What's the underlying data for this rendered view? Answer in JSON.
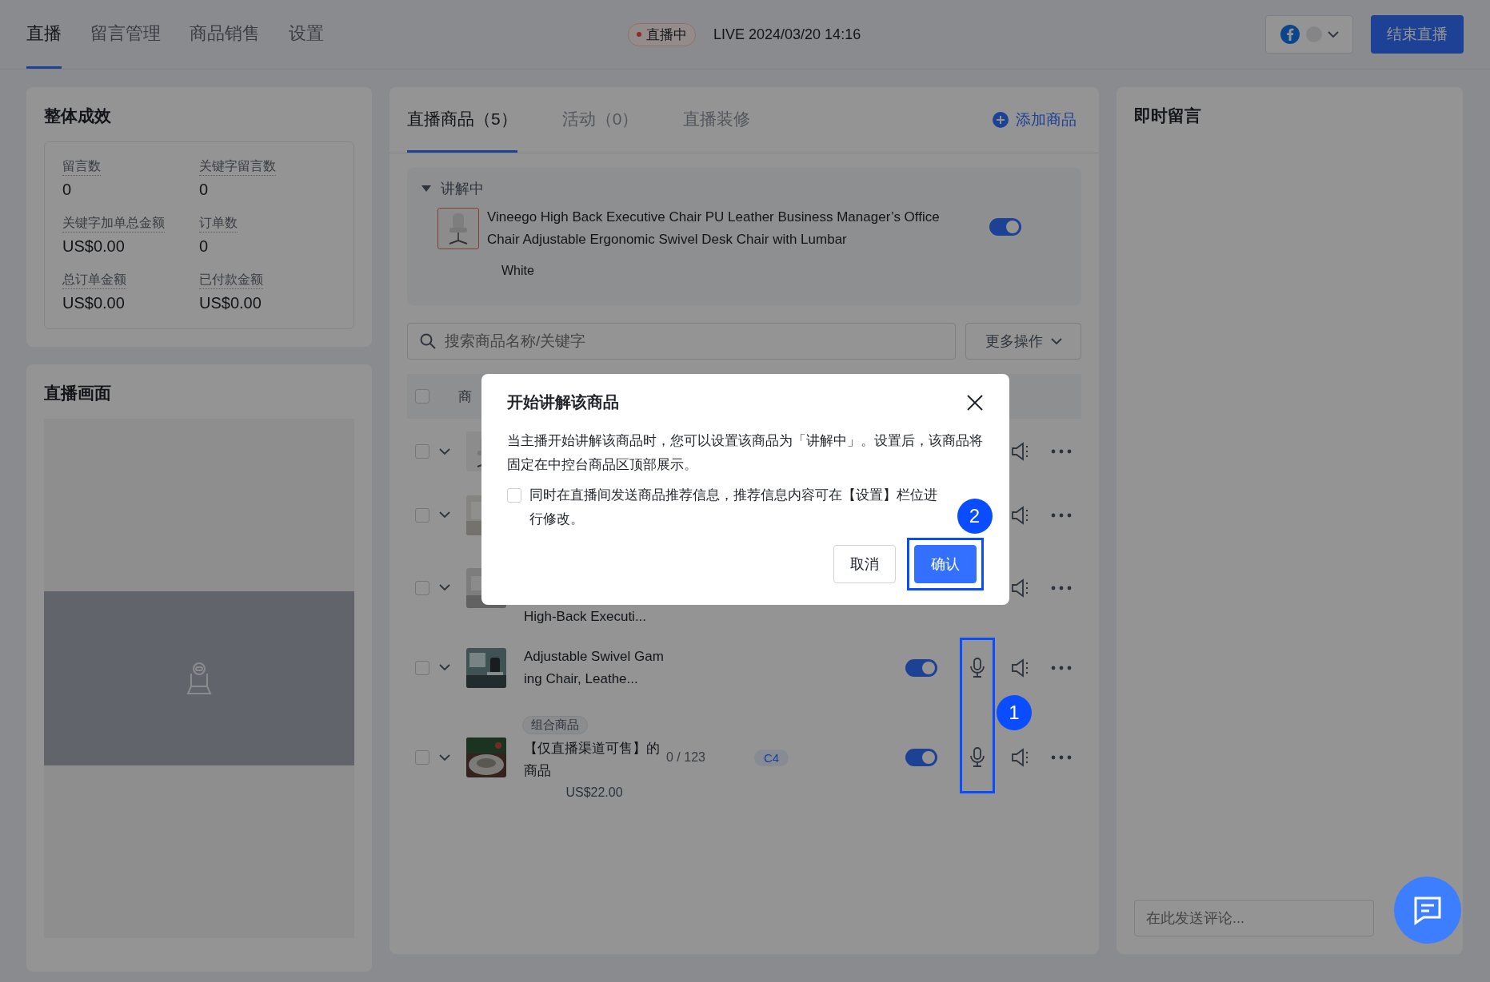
{
  "top_bar": {
    "tabs": [
      {
        "label": "直播",
        "selected": true
      },
      {
        "label": "留言管理",
        "selected": false
      },
      {
        "label": "商品销售",
        "selected": false
      },
      {
        "label": "设置",
        "selected": false
      }
    ],
    "status_badge": "直播中",
    "live_time": "LIVE 2024/03/20 14:16",
    "end_button": "结束直播"
  },
  "overview": {
    "title": "整体成效",
    "stats": [
      {
        "label": "留言数",
        "value": "0"
      },
      {
        "label": "关键字留言数",
        "value": "0"
      },
      {
        "label": "关键字加单总金额",
        "value": "US$0.00"
      },
      {
        "label": "订单数",
        "value": "0"
      },
      {
        "label": "总订单金额",
        "value": "US$0.00"
      },
      {
        "label": "已付款金额",
        "value": "US$0.00"
      }
    ]
  },
  "stream_view": {
    "title": "直播画面"
  },
  "products": {
    "tabs": [
      {
        "label": "直播商品（5）",
        "selected": true
      },
      {
        "label": "活动（0）",
        "selected": false
      },
      {
        "label": "直播装修",
        "selected": false
      }
    ],
    "add_button": "添加商品",
    "featured": {
      "heading": "讲解中",
      "expanded": true,
      "title": "Vineego High Back Executive Chair PU Leather Business Manager’s Office Chair Adjustable Ergonomic Swivel Desk Chair with Lumbar",
      "switch_on": true,
      "variant": "White"
    },
    "search": {
      "placeholder": "搜索商品名称/关键字"
    },
    "more_button": "更多操作",
    "header": {
      "checked": false,
      "column_1": "商"
    },
    "rows": [
      {
        "checked": false
      },
      {
        "checked": false
      },
      {
        "checked": false,
        "title": "High-Back Executi..."
      },
      {
        "checked": false,
        "title": "Adjustable Swivel Gaming Chair, Leathe...",
        "switch_on": true
      },
      {
        "checked": false,
        "tag": "组合商品",
        "title": "【仅直播渠道可售】的商品",
        "price": "US$22.00",
        "count": "0 / 123",
        "badge": "C4",
        "switch_on": true
      }
    ]
  },
  "comments": {
    "title": "即时留言",
    "input": {
      "placeholder": "在此发送评论..."
    }
  },
  "dialog": {
    "title": "开始讲解该商品",
    "message": "当主播开始讲解该商品时，您可以设置该商品为「讲解中」。设置后，该商品将固定在中控台商品区顶部展示。",
    "option": {
      "label": "同时在直播间发送商品推荐信息，推荐信息内容可在【设置】栏位进行修改。",
      "checked": false
    },
    "buttons": [
      {
        "label": "取消",
        "kind": "secondary"
      },
      {
        "label": "确认",
        "kind": "primary"
      }
    ]
  },
  "annotations": [
    {
      "label": "1"
    },
    {
      "label": "2"
    }
  ]
}
